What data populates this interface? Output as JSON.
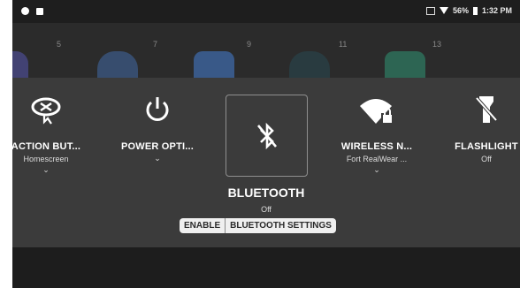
{
  "status_bar": {
    "battery": "56%",
    "time": "1:32 PM"
  },
  "home_numbers": [
    "5",
    "7",
    "9",
    "11",
    "13"
  ],
  "tiles": [
    {
      "title": "ACTION BUT...",
      "subtitle": "Homescreen",
      "icon": "action-button-icon"
    },
    {
      "title": "POWER OPTI...",
      "subtitle": "",
      "icon": "power-icon"
    },
    {
      "title": "WIRELESS N...",
      "subtitle": "Fort RealWear ...",
      "icon": "wifi-lock-icon"
    },
    {
      "title": "FLASHLIGHT",
      "subtitle": "Off",
      "icon": "flashlight-off-icon"
    }
  ],
  "bluetooth": {
    "title": "BLUETOOTH",
    "status": "Off",
    "enable_label": "ENABLE",
    "settings_label": "BLUETOOTH SETTINGS",
    "icon": "bluetooth-off-icon"
  },
  "colors": {
    "background": "#232323",
    "panel": "#3b3b3b",
    "accent": "#ffffff"
  }
}
